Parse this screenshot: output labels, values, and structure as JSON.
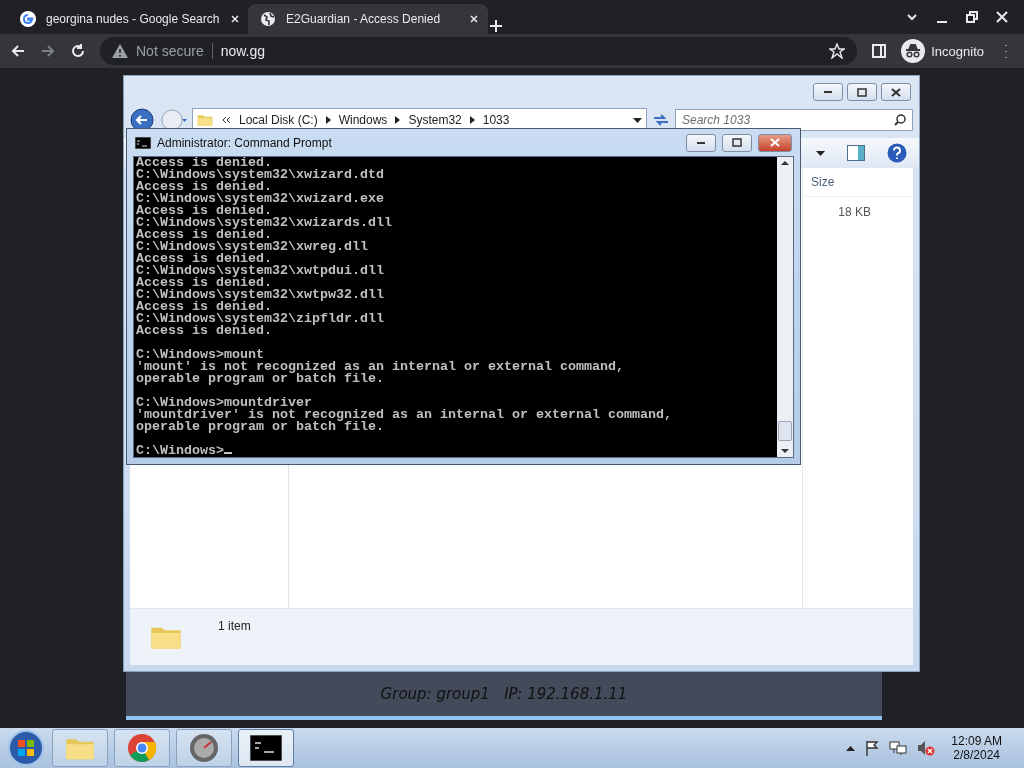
{
  "browser": {
    "tabs": [
      {
        "title": "georgina nudes - Google Search",
        "kind": "google",
        "selected": false
      },
      {
        "title": "E2Guardian - Access Denied",
        "kind": "globe",
        "selected": true
      }
    ],
    "security": "Not secure",
    "url": "now.gg",
    "profile": "Incognito"
  },
  "explorer": {
    "breadcrumb": [
      "Local Disk (C:)",
      "Windows",
      "System32",
      "1033"
    ],
    "search": {
      "placeholder": "Search 1033"
    },
    "columns": [
      "Size"
    ],
    "rows": [
      {
        "size": "18 KB"
      }
    ],
    "details": "1 item"
  },
  "cmd": {
    "title": "Administrator:  Command Prompt",
    "blocks": [
      [
        "Access is denied.",
        "C:\\Windows\\system32\\xwizard.dtd",
        "Access is denied.",
        "C:\\Windows\\system32\\xwizard.exe",
        "Access is denied.",
        "C:\\Windows\\system32\\xwizards.dll",
        "Access is denied.",
        "C:\\Windows\\system32\\xwreg.dll",
        "Access is denied.",
        "C:\\Windows\\system32\\xwtpdui.dll",
        "Access is denied.",
        "C:\\Windows\\system32\\xwtpw32.dll",
        "Access is denied.",
        "C:\\Windows\\system32\\zipfldr.dll",
        "Access is denied."
      ],
      [
        "C:\\Windows>mount",
        "'mount' is not recognized as an internal or external command,",
        "operable program or batch file."
      ],
      [
        "C:\\Windows>mountdriver",
        "'mountdriver' is not recognized as an internal or external command,",
        "operable program or batch file."
      ],
      [
        "C:\\Windows>"
      ]
    ]
  },
  "status": "Group: group1   IP: 192.168.1.11",
  "taskbar": {
    "apps": [
      {
        "kind": "explorer",
        "selected": false
      },
      {
        "kind": "chrome",
        "selected": false
      },
      {
        "kind": "gauge",
        "selected": false
      },
      {
        "kind": "cmd",
        "selected": true
      }
    ],
    "time": "12:09 AM",
    "date": "2/8/2024"
  }
}
